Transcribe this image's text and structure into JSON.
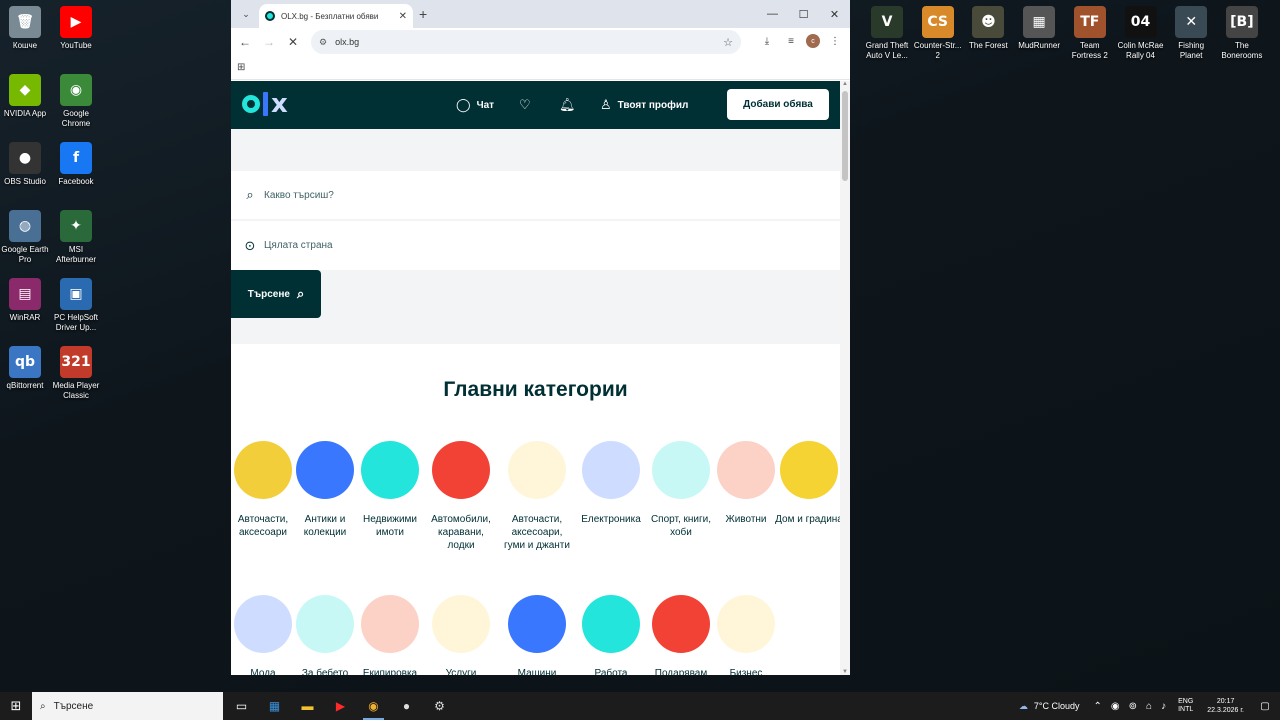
{
  "desktop": {
    "left_icons": [
      {
        "label": "Кошче",
        "glyph": "🗑",
        "color": "#7a8a94"
      },
      {
        "label": "YouTube",
        "glyph": "▶",
        "color": "#ff0000"
      },
      {
        "label": "NVIDIA App",
        "glyph": "◆",
        "color": "#76b900"
      },
      {
        "label": "Google Chrome",
        "glyph": "◉",
        "color": "#3a8a3a"
      },
      {
        "label": "OBS Studio",
        "glyph": "●",
        "color": "#333333"
      },
      {
        "label": "Facebook",
        "glyph": "f",
        "color": "#1877f2"
      },
      {
        "label": "Google Earth Pro",
        "glyph": "◍",
        "color": "#4a6f95"
      },
      {
        "label": "MSI Afterburner",
        "glyph": "✦",
        "color": "#2a6a3a"
      },
      {
        "label": "WinRAR",
        "glyph": "▤",
        "color": "#8a2a6a"
      },
      {
        "label": "PC HelpSoft Driver Up...",
        "glyph": "▣",
        "color": "#2a6ab0"
      },
      {
        "label": "qBittorrent",
        "glyph": "qb",
        "color": "#3b76c4"
      },
      {
        "label": "Media Player Classic",
        "glyph": "321",
        "color": "#c23a2a"
      }
    ],
    "right_icons": [
      {
        "label": "Grand Theft Auto V Le...",
        "glyph": "V",
        "color": "#2a3a2a"
      },
      {
        "label": "Counter-Str... 2",
        "glyph": "CS",
        "color": "#d8892a"
      },
      {
        "label": "The Forest",
        "glyph": "☻",
        "color": "#4a4a3a"
      },
      {
        "label": "MudRunner",
        "glyph": "▦",
        "color": "#555555"
      },
      {
        "label": "Team Fortress 2",
        "glyph": "TF",
        "color": "#a0522d"
      },
      {
        "label": "Colin McRae Rally 04",
        "glyph": "04",
        "color": "#111111"
      },
      {
        "label": "Fishing Planet",
        "glyph": "✕",
        "color": "#3a4a55"
      },
      {
        "label": "The Bonerooms",
        "glyph": "[B]",
        "color": "#444444"
      }
    ]
  },
  "browser": {
    "tab_title": "OLX.bg - Безплатни обяви",
    "url": "olx.bg",
    "profile_initial": "c",
    "new_tab": "+",
    "tab_close": "✕"
  },
  "olx": {
    "header": {
      "chat": "Чат",
      "profile": "Твоят профил",
      "post_ad": "Добави обява"
    },
    "search": {
      "query_placeholder": "Какво търсиш?",
      "location_placeholder": "Цялата страна",
      "button": "Търсене"
    },
    "categories_title": "Главни категории",
    "categories_row1": [
      {
        "label": "Авточасти, аксесоари",
        "color": "#f2cf3a"
      },
      {
        "label": "Антики и колекции",
        "color": "#3a77ff"
      },
      {
        "label": "Недвижими имоти",
        "color": "#23e5db"
      },
      {
        "label": "Автомобили, каравани, лодки",
        "color": "#f24236"
      },
      {
        "label": "Авточасти, аксесоари, гуми и джанти",
        "color": "#fff6d9"
      },
      {
        "label": "Електроника",
        "color": "#ceddff"
      },
      {
        "label": "Спорт, книги, хоби",
        "color": "#c8f8f6"
      },
      {
        "label": "Животни",
        "color": "#fcd1c6"
      },
      {
        "label": "Дом и градина",
        "color": "#f5d332"
      }
    ],
    "categories_row2": [
      {
        "label": "Мода",
        "color": "#ceddff"
      },
      {
        "label": "За бебето",
        "color": "#c8f8f6"
      },
      {
        "label": "Екипировка",
        "color": "#fcd1c6"
      },
      {
        "label": "Услуги",
        "color": "#fff6d9"
      },
      {
        "label": "Машини",
        "color": "#3a77ff"
      },
      {
        "label": "Работа",
        "color": "#23e5db"
      },
      {
        "label": "Подарявам",
        "color": "#f24236"
      },
      {
        "label": "Бизнес",
        "color": "#fff6d9"
      }
    ]
  },
  "taskbar": {
    "search_placeholder": "Търсене",
    "weather": "7°C  Cloudy",
    "lang_1": "ENG",
    "lang_2": "INTL",
    "time": "20:17",
    "date": "22.3.2026 г."
  }
}
